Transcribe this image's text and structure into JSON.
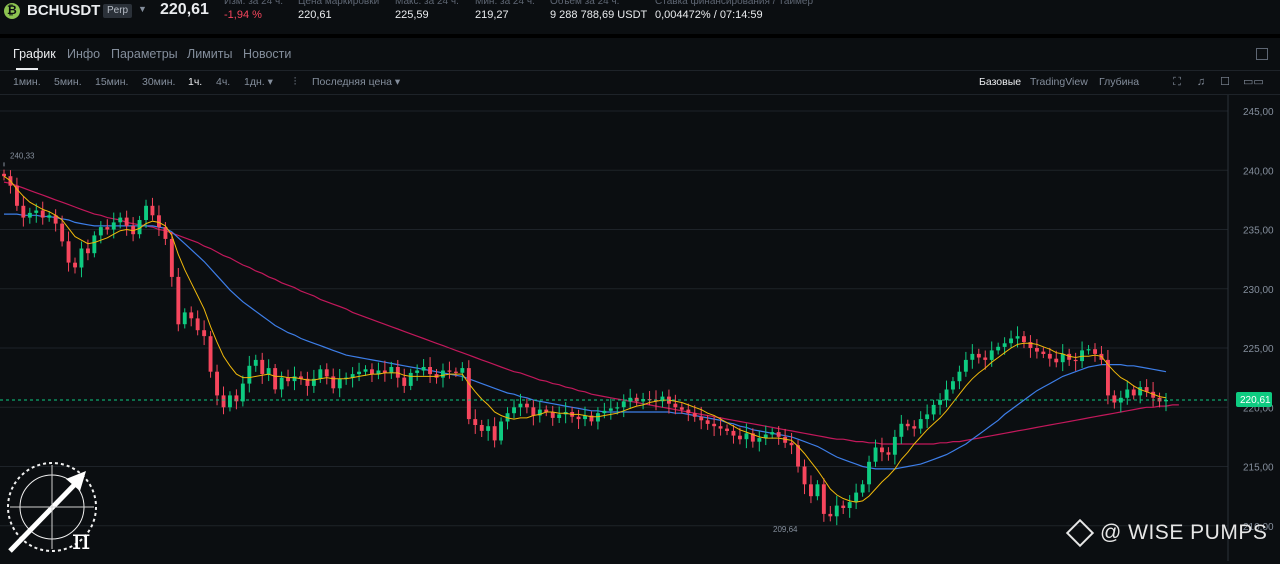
{
  "header": {
    "symbol": "BCHUSDT",
    "badge": "Perp",
    "last_price": "220,61",
    "stats": [
      {
        "label": "Изм. за 24 ч.",
        "value": "-1,94 %",
        "negative": true
      },
      {
        "label": "Цена маркировки",
        "value": "220,61",
        "negative": false
      },
      {
        "label": "Макс. за 24 ч.",
        "value": "225,59",
        "negative": false
      },
      {
        "label": "Мин. за 24 ч.",
        "value": "219,27",
        "negative": false
      },
      {
        "label": "Объем за 24 ч.",
        "value": "9 288 788,69 USDT",
        "negative": false
      },
      {
        "label": "Ставка финансирования / Таймер",
        "value": "0,004472% / 07:14:59",
        "negative": false
      }
    ]
  },
  "tabs": [
    "График",
    "Инфо",
    "Параметры",
    "Лимиты",
    "Новости"
  ],
  "toolbar": {
    "timeframes": [
      "1мин.",
      "5мин.",
      "15мин.",
      "30мин.",
      "1ч.",
      "4ч.",
      "1дн. ▾"
    ],
    "active_timeframe": "1ч.",
    "price_type": "Последняя цена ▾",
    "views": [
      "Базовые",
      "TradingView",
      "Глубина"
    ],
    "active_view": "Базовые"
  },
  "chart_data": {
    "type": "candlestick",
    "y_ticks": [
      "245,00",
      "240,00",
      "235,00",
      "230,00",
      "225,00",
      "220,00",
      "215,00",
      "210,00"
    ],
    "ylim": [
      209.5,
      246.2
    ],
    "current_price": 220.61,
    "current_price_label": "220,61",
    "high_label": "240,33",
    "low_label": "209,64",
    "colors": {
      "up": "#0ecb81",
      "down": "#f6465d",
      "ma_fast": "#f0b90b",
      "ma_mid": "#3d7ee8",
      "ma_slow": "#c2185b",
      "grid": "#1e2329",
      "axis_text": "#848e9c"
    },
    "close_series": [
      239.5,
      238.7,
      237.0,
      236.0,
      236.4,
      236.6,
      236.0,
      236.2,
      235.5,
      234.0,
      232.2,
      231.8,
      233.4,
      233.0,
      234.5,
      235.2,
      235.0,
      235.6,
      236.0,
      235.3,
      234.6,
      235.8,
      237.0,
      236.2,
      235.2,
      234.2,
      231.0,
      227.0,
      228.0,
      227.5,
      226.5,
      226.0,
      223.0,
      221.0,
      220.0,
      221.0,
      220.5,
      222.0,
      223.5,
      224.0,
      222.8,
      223.3,
      221.5,
      222.5,
      222.2,
      222.6,
      222.4,
      221.8,
      222.4,
      223.2,
      222.6,
      221.6,
      222.4,
      222.5,
      222.8,
      223.0,
      223.2,
      222.8,
      223.1,
      222.9,
      223.4,
      222.5,
      221.8,
      222.9,
      223.1,
      223.4,
      222.8,
      222.5,
      223.1,
      223.0,
      222.9,
      223.3,
      219.0,
      218.5,
      218.0,
      218.4,
      217.2,
      218.8,
      219.5,
      220.0,
      220.3,
      220.0,
      219.3,
      219.8,
      219.6,
      219.1,
      219.4,
      219.6,
      219.2,
      219.0,
      219.3,
      218.8,
      219.5,
      219.7,
      219.9,
      220.0,
      220.5,
      220.8,
      220.5,
      220.7,
      220.6,
      220.5,
      220.9,
      220.3,
      220.0,
      219.8,
      219.5,
      219.2,
      218.9,
      218.6,
      218.4,
      218.2,
      218.0,
      217.6,
      217.3,
      217.8,
      217.1,
      217.4,
      217.7,
      217.9,
      217.5,
      217.0,
      216.8,
      215.0,
      213.5,
      212.5,
      213.5,
      211.0,
      210.8,
      211.7,
      211.5,
      212.0,
      212.8,
      213.5,
      215.4,
      216.6,
      216.2,
      216.0,
      217.5,
      218.6,
      218.4,
      218.2,
      219.0,
      219.4,
      220.2,
      220.6,
      221.5,
      222.2,
      223.0,
      224.0,
      224.5,
      224.2,
      224.0,
      224.8,
      225.1,
      225.4,
      225.8,
      226.0,
      225.5,
      225.0,
      224.7,
      224.5,
      224.1,
      223.8,
      224.5,
      224.0,
      223.9,
      224.8,
      224.9,
      224.5,
      224.0,
      221.0,
      220.4,
      220.8,
      221.5,
      221.0,
      221.7,
      221.3,
      220.8,
      220.5,
      220.61
    ],
    "ma_fast": [
      239.5,
      239.1,
      238.4,
      237.8,
      237.3,
      237.0,
      236.7,
      236.5,
      236.2,
      235.8,
      235.1,
      234.4,
      234.1,
      233.8,
      233.9,
      234.1,
      234.3,
      234.6,
      234.9,
      235.0,
      234.9,
      235.1,
      235.5,
      235.7,
      235.6,
      235.3,
      234.5,
      232.9,
      231.6,
      230.5,
      229.4,
      228.3,
      226.8,
      225.5,
      224.3,
      223.5,
      222.8,
      222.5,
      222.5,
      222.6,
      222.7,
      222.8,
      222.6,
      222.6,
      222.5,
      222.5,
      222.4,
      222.3,
      222.3,
      222.4,
      222.5,
      222.4,
      222.4,
      222.4,
      222.5,
      222.6,
      222.7,
      222.8,
      222.8,
      222.9,
      222.9,
      222.9,
      222.7,
      222.6,
      222.6,
      222.6,
      222.6,
      222.6,
      222.7,
      222.8,
      222.8,
      222.8,
      222.0,
      221.3,
      220.7,
      220.2,
      219.6,
      219.3,
      219.1,
      219.0,
      219.1,
      219.1,
      219.3,
      219.4,
      219.6,
      219.6,
      219.5,
      219.5,
      219.4,
      219.4,
      219.3,
      219.2,
      219.2,
      219.3,
      219.4,
      219.5,
      219.7,
      219.9,
      220.1,
      220.2,
      220.4,
      220.5,
      220.6,
      220.6,
      220.5,
      220.4,
      220.2,
      220.0,
      219.8,
      219.5,
      219.3,
      219.0,
      218.7,
      218.4,
      218.1,
      217.9,
      217.7,
      217.5,
      217.4,
      217.4,
      217.4,
      217.3,
      217.2,
      216.7,
      216.1,
      215.4,
      214.7,
      213.9,
      213.1,
      212.6,
      212.3,
      212.1,
      212.0,
      212.1,
      212.5,
      213.1,
      213.7,
      214.2,
      214.8,
      215.6,
      216.2,
      216.9,
      217.5,
      218.1,
      218.6,
      219.1,
      219.7,
      220.4,
      221.1,
      221.8,
      222.4,
      222.9,
      223.3,
      223.8,
      224.2,
      224.6,
      225.0,
      225.3,
      225.4,
      225.4,
      225.3,
      225.1,
      224.9,
      224.6,
      224.5,
      224.3,
      224.2,
      224.3,
      224.3,
      224.4,
      224.3,
      223.6,
      223.0,
      222.5,
      222.2,
      221.8,
      221.5,
      221.3,
      221.1,
      220.9,
      220.8
    ],
    "ma_mid": [
      236.3,
      236.3,
      236.3,
      236.2,
      236.2,
      236.2,
      236.1,
      236.1,
      236.0,
      235.9,
      235.8,
      235.6,
      235.5,
      235.4,
      235.3,
      235.3,
      235.3,
      235.3,
      235.3,
      235.3,
      235.3,
      235.3,
      235.3,
      235.3,
      235.2,
      235.1,
      234.8,
      234.3,
      233.8,
      233.3,
      232.8,
      232.3,
      231.7,
      231.1,
      230.5,
      229.9,
      229.4,
      228.9,
      228.5,
      228.1,
      227.7,
      227.3,
      226.9,
      226.6,
      226.3,
      226.1,
      225.8,
      225.6,
      225.4,
      225.2,
      225.0,
      224.8,
      224.6,
      224.4,
      224.3,
      224.2,
      224.1,
      224.0,
      223.9,
      223.8,
      223.7,
      223.6,
      223.5,
      223.4,
      223.3,
      223.2,
      223.1,
      223.0,
      222.9,
      222.8,
      222.7,
      222.6,
      222.4,
      222.2,
      222.0,
      221.8,
      221.6,
      221.4,
      221.2,
      221.1,
      220.9,
      220.8,
      220.6,
      220.5,
      220.4,
      220.3,
      220.2,
      220.1,
      220.0,
      219.9,
      219.8,
      219.7,
      219.7,
      219.6,
      219.6,
      219.6,
      219.6,
      219.6,
      219.6,
      219.6,
      219.6,
      219.6,
      219.6,
      219.6,
      219.5,
      219.5,
      219.4,
      219.3,
      219.2,
      219.1,
      219.0,
      218.9,
      218.7,
      218.6,
      218.4,
      218.3,
      218.1,
      218.0,
      217.9,
      217.8,
      217.7,
      217.6,
      217.5,
      217.3,
      217.1,
      216.9,
      216.7,
      216.4,
      216.1,
      215.8,
      215.6,
      215.4,
      215.2,
      215.0,
      214.9,
      214.8,
      214.8,
      214.8,
      214.8,
      214.9,
      215.0,
      215.1,
      215.2,
      215.4,
      215.6,
      215.8,
      216.0,
      216.3,
      216.6,
      216.9,
      217.3,
      217.7,
      218.1,
      218.5,
      218.9,
      219.4,
      219.8,
      220.2,
      220.6,
      221.0,
      221.4,
      221.7,
      222.0,
      222.3,
      222.6,
      222.8,
      223.0,
      223.2,
      223.4,
      223.5,
      223.6,
      223.6,
      223.6,
      223.6,
      223.5,
      223.5,
      223.4,
      223.3,
      223.2,
      223.1,
      223.0
    ],
    "ma_slow": [
      239.0,
      238.9,
      238.7,
      238.5,
      238.3,
      238.1,
      237.9,
      237.7,
      237.5,
      237.3,
      237.1,
      236.9,
      236.7,
      236.5,
      236.3,
      236.2,
      236.0,
      235.9,
      235.8,
      235.6,
      235.5,
      235.4,
      235.3,
      235.2,
      235.0,
      234.9,
      234.7,
      234.5,
      234.3,
      234.1,
      233.9,
      233.6,
      233.4,
      233.1,
      232.8,
      232.6,
      232.3,
      232.0,
      231.8,
      231.5,
      231.3,
      231.0,
      230.8,
      230.5,
      230.3,
      230.1,
      229.8,
      229.6,
      229.4,
      229.1,
      228.9,
      228.7,
      228.5,
      228.3,
      228.0,
      227.8,
      227.6,
      227.4,
      227.2,
      227.0,
      226.8,
      226.6,
      226.4,
      226.2,
      226.0,
      225.8,
      225.6,
      225.4,
      225.2,
      225.0,
      224.8,
      224.6,
      224.4,
      224.2,
      224.0,
      223.8,
      223.6,
      223.4,
      223.2,
      223.0,
      222.9,
      222.7,
      222.5,
      222.3,
      222.2,
      222.0,
      221.9,
      221.7,
      221.6,
      221.4,
      221.3,
      221.1,
      221.0,
      220.9,
      220.8,
      220.7,
      220.6,
      220.5,
      220.4,
      220.3,
      220.2,
      220.1,
      220.0,
      219.9,
      219.8,
      219.7,
      219.6,
      219.5,
      219.4,
      219.3,
      219.2,
      219.1,
      219.0,
      218.9,
      218.8,
      218.7,
      218.6,
      218.5,
      218.4,
      218.3,
      218.2,
      218.1,
      218.0,
      217.9,
      217.8,
      217.7,
      217.6,
      217.5,
      217.4,
      217.3,
      217.3,
      217.2,
      217.1,
      217.1,
      217.0,
      217.0,
      216.9,
      216.9,
      216.9,
      216.9,
      216.9,
      216.9,
      216.9,
      216.9,
      216.9,
      217.0,
      217.0,
      217.1,
      217.1,
      217.2,
      217.3,
      217.4,
      217.5,
      217.6,
      217.7,
      217.8,
      217.9,
      218.0,
      218.1,
      218.2,
      218.3,
      218.4,
      218.5,
      218.6,
      218.7,
      218.8,
      218.9,
      219.0,
      219.1,
      219.2,
      219.3,
      219.4,
      219.5,
      219.6,
      219.7,
      219.8,
      219.9,
      220.0,
      220.0,
      220.1,
      220.1,
      220.2,
      220.2
    ]
  },
  "watermark": {
    "left_symbol": "π",
    "right_text": "@ WISE PUMPS"
  }
}
